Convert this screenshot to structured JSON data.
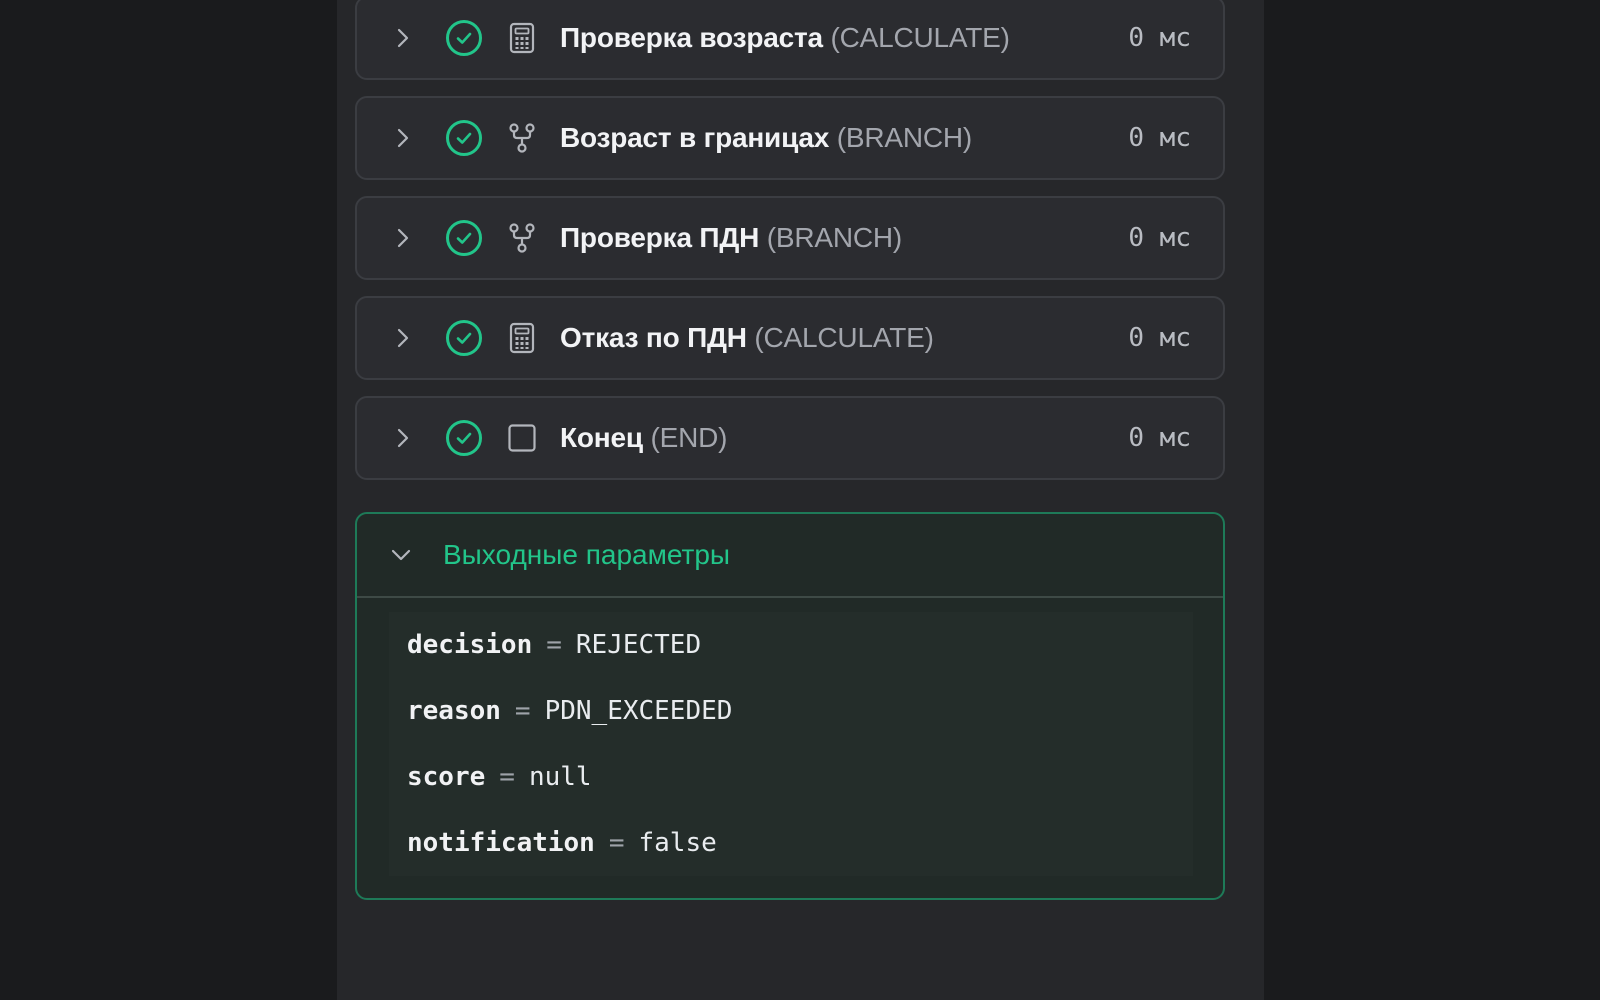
{
  "steps": [
    {
      "name": "Проверка возраста",
      "kind": "(CALCULATE)",
      "icon": "calculator-icon",
      "duration": "0 мс",
      "status": "success"
    },
    {
      "name": "Возраст в границах",
      "kind": "(BRANCH)",
      "icon": "branch-icon",
      "duration": "0 мс",
      "status": "success"
    },
    {
      "name": "Проверка ПДН",
      "kind": "(BRANCH)",
      "icon": "branch-icon",
      "duration": "0 мс",
      "status": "success"
    },
    {
      "name": "Отказ по ПДН",
      "kind": "(CALCULATE)",
      "icon": "calculator-icon",
      "duration": "0 мс",
      "status": "success"
    },
    {
      "name": "Конец",
      "kind": "(END)",
      "icon": "square-icon",
      "duration": "0 мс",
      "status": "success"
    }
  ],
  "output": {
    "title": "Выходные параметры",
    "params": [
      {
        "key": "decision",
        "eq": "=",
        "value": "REJECTED"
      },
      {
        "key": "reason",
        "eq": "=",
        "value": "PDN_EXCEEDED"
      },
      {
        "key": "score",
        "eq": "=",
        "value": "null"
      },
      {
        "key": "notification",
        "eq": "=",
        "value": "false"
      }
    ]
  },
  "colors": {
    "success": "#22c58a",
    "accent_border": "#1e7a58",
    "background": "#26272a"
  }
}
